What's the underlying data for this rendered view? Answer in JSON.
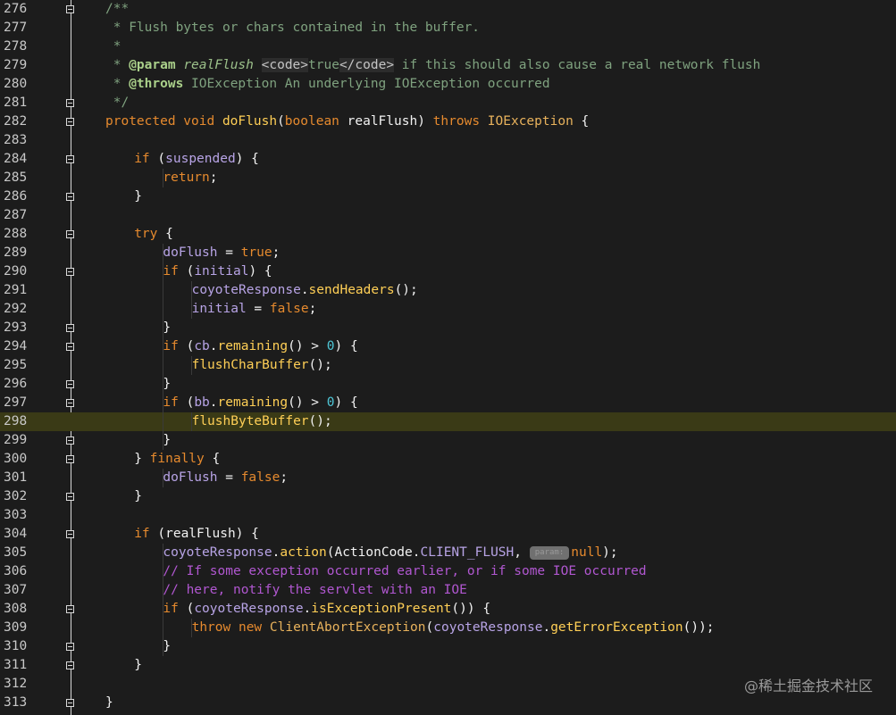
{
  "editor": {
    "active_line": 298,
    "lines": [
      {
        "n": 276,
        "indent": 0,
        "fold": true,
        "tokens": [
          {
            "t": "/**",
            "c": "comment"
          }
        ]
      },
      {
        "n": 277,
        "indent": 0,
        "fold": false,
        "tokens": [
          {
            "t": " * Flush bytes or chars contained in the buffer.",
            "c": "comment"
          }
        ]
      },
      {
        "n": 278,
        "indent": 0,
        "fold": false,
        "tokens": [
          {
            "t": " *",
            "c": "comment"
          }
        ]
      },
      {
        "n": 279,
        "indent": 0,
        "fold": false,
        "tokens": [
          {
            "t": " * ",
            "c": "comment"
          },
          {
            "t": "@param",
            "c": "doctag"
          },
          {
            "t": " ",
            "c": "comment"
          },
          {
            "t": "realFlush",
            "c": "docparam"
          },
          {
            "t": " ",
            "c": "comment"
          },
          {
            "t": "<code>",
            "c": "codetag"
          },
          {
            "t": "true",
            "c": "comment"
          },
          {
            "t": "</code>",
            "c": "codetag"
          },
          {
            "t": " if this should also cause a real network flush",
            "c": "comment"
          }
        ]
      },
      {
        "n": 280,
        "indent": 0,
        "fold": false,
        "tokens": [
          {
            "t": " * ",
            "c": "comment"
          },
          {
            "t": "@throws",
            "c": "doctag"
          },
          {
            "t": " IOException An underlying IOException occurred",
            "c": "comment"
          }
        ]
      },
      {
        "n": 281,
        "indent": 0,
        "fold": true,
        "tokens": [
          {
            "t": " */",
            "c": "comment"
          }
        ]
      },
      {
        "n": 282,
        "indent": 0,
        "fold": true,
        "tokens": [
          {
            "t": "protected void ",
            "c": "kw"
          },
          {
            "t": "doFlush",
            "c": "method"
          },
          {
            "t": "(",
            "c": "plain"
          },
          {
            "t": "boolean ",
            "c": "kw"
          },
          {
            "t": "realFlush) ",
            "c": "plain"
          },
          {
            "t": "throws ",
            "c": "kw"
          },
          {
            "t": "IOException",
            "c": "type"
          },
          {
            "t": " {",
            "c": "plain"
          }
        ]
      },
      {
        "n": 283,
        "indent": 0,
        "fold": false,
        "tokens": []
      },
      {
        "n": 284,
        "indent": 1,
        "fold": true,
        "tokens": [
          {
            "t": "if ",
            "c": "kw"
          },
          {
            "t": "(",
            "c": "plain"
          },
          {
            "t": "suspended",
            "c": "field"
          },
          {
            "t": ") {",
            "c": "plain"
          }
        ]
      },
      {
        "n": 285,
        "indent": 2,
        "fold": false,
        "tokens": [
          {
            "t": "return",
            "c": "kw"
          },
          {
            "t": ";",
            "c": "plain"
          }
        ]
      },
      {
        "n": 286,
        "indent": 1,
        "fold": true,
        "tokens": [
          {
            "t": "}",
            "c": "plain"
          }
        ]
      },
      {
        "n": 287,
        "indent": 0,
        "fold": false,
        "tokens": []
      },
      {
        "n": 288,
        "indent": 1,
        "fold": true,
        "tokens": [
          {
            "t": "try",
            "c": "kw"
          },
          {
            "t": " {",
            "c": "plain"
          }
        ]
      },
      {
        "n": 289,
        "indent": 2,
        "fold": false,
        "tokens": [
          {
            "t": "doFlush",
            "c": "field"
          },
          {
            "t": " = ",
            "c": "plain"
          },
          {
            "t": "true",
            "c": "kw"
          },
          {
            "t": ";",
            "c": "plain"
          }
        ]
      },
      {
        "n": 290,
        "indent": 2,
        "fold": true,
        "tokens": [
          {
            "t": "if ",
            "c": "kw"
          },
          {
            "t": "(",
            "c": "plain"
          },
          {
            "t": "initial",
            "c": "field"
          },
          {
            "t": ") {",
            "c": "plain"
          }
        ]
      },
      {
        "n": 291,
        "indent": 3,
        "fold": false,
        "tokens": [
          {
            "t": "coyoteResponse",
            "c": "field"
          },
          {
            "t": ".",
            "c": "plain"
          },
          {
            "t": "sendHeaders",
            "c": "method"
          },
          {
            "t": "();",
            "c": "plain"
          }
        ]
      },
      {
        "n": 292,
        "indent": 3,
        "fold": false,
        "tokens": [
          {
            "t": "initial",
            "c": "field"
          },
          {
            "t": " = ",
            "c": "plain"
          },
          {
            "t": "false",
            "c": "kw"
          },
          {
            "t": ";",
            "c": "plain"
          }
        ]
      },
      {
        "n": 293,
        "indent": 2,
        "fold": true,
        "tokens": [
          {
            "t": "}",
            "c": "plain"
          }
        ]
      },
      {
        "n": 294,
        "indent": 2,
        "fold": true,
        "tokens": [
          {
            "t": "if ",
            "c": "kw"
          },
          {
            "t": "(",
            "c": "plain"
          },
          {
            "t": "cb",
            "c": "field"
          },
          {
            "t": ".",
            "c": "plain"
          },
          {
            "t": "remaining",
            "c": "method"
          },
          {
            "t": "() > ",
            "c": "plain"
          },
          {
            "t": "0",
            "c": "num"
          },
          {
            "t": ") {",
            "c": "plain"
          }
        ]
      },
      {
        "n": 295,
        "indent": 3,
        "fold": false,
        "tokens": [
          {
            "t": "flushCharBuffer",
            "c": "method"
          },
          {
            "t": "();",
            "c": "plain"
          }
        ]
      },
      {
        "n": 296,
        "indent": 2,
        "fold": true,
        "tokens": [
          {
            "t": "}",
            "c": "plain"
          }
        ]
      },
      {
        "n": 297,
        "indent": 2,
        "fold": true,
        "tokens": [
          {
            "t": "if ",
            "c": "kw"
          },
          {
            "t": "(",
            "c": "plain"
          },
          {
            "t": "bb",
            "c": "field"
          },
          {
            "t": ".",
            "c": "plain"
          },
          {
            "t": "remaining",
            "c": "method"
          },
          {
            "t": "() > ",
            "c": "plain"
          },
          {
            "t": "0",
            "c": "num"
          },
          {
            "t": ") {",
            "c": "plain"
          }
        ]
      },
      {
        "n": 298,
        "indent": 3,
        "fold": false,
        "tokens": [
          {
            "t": "flushByteBuffer",
            "c": "method"
          },
          {
            "t": "();",
            "c": "plain"
          }
        ]
      },
      {
        "n": 299,
        "indent": 2,
        "fold": true,
        "tokens": [
          {
            "t": "}",
            "c": "plain"
          }
        ]
      },
      {
        "n": 300,
        "indent": 1,
        "fold": true,
        "tokens": [
          {
            "t": "} ",
            "c": "plain"
          },
          {
            "t": "finally",
            "c": "kw"
          },
          {
            "t": " {",
            "c": "plain"
          }
        ]
      },
      {
        "n": 301,
        "indent": 2,
        "fold": false,
        "tokens": [
          {
            "t": "doFlush",
            "c": "field"
          },
          {
            "t": " = ",
            "c": "plain"
          },
          {
            "t": "false",
            "c": "kw"
          },
          {
            "t": ";",
            "c": "plain"
          }
        ]
      },
      {
        "n": 302,
        "indent": 1,
        "fold": true,
        "tokens": [
          {
            "t": "}",
            "c": "plain"
          }
        ]
      },
      {
        "n": 303,
        "indent": 0,
        "fold": false,
        "tokens": []
      },
      {
        "n": 304,
        "indent": 1,
        "fold": true,
        "tokens": [
          {
            "t": "if ",
            "c": "kw"
          },
          {
            "t": "(realFlush) {",
            "c": "plain"
          }
        ]
      },
      {
        "n": 305,
        "indent": 2,
        "fold": false,
        "tokens": [
          {
            "t": "coyoteResponse",
            "c": "field"
          },
          {
            "t": ".",
            "c": "plain"
          },
          {
            "t": "action",
            "c": "method"
          },
          {
            "t": "(ActionCode.",
            "c": "plain"
          },
          {
            "t": "CLIENT_FLUSH",
            "c": "field"
          },
          {
            "t": ", ",
            "c": "plain"
          },
          {
            "t": "param:",
            "c": "hint"
          },
          {
            "t": "null",
            "c": "kw"
          },
          {
            "t": ");",
            "c": "plain"
          }
        ]
      },
      {
        "n": 306,
        "indent": 2,
        "fold": false,
        "tokens": [
          {
            "t": "// If some exception occurred earlier, or if some IOE occurred",
            "c": "linecomment"
          }
        ]
      },
      {
        "n": 307,
        "indent": 2,
        "fold": false,
        "tokens": [
          {
            "t": "// here, notify the servlet with an IOE",
            "c": "linecomment"
          }
        ]
      },
      {
        "n": 308,
        "indent": 2,
        "fold": true,
        "tokens": [
          {
            "t": "if ",
            "c": "kw"
          },
          {
            "t": "(",
            "c": "plain"
          },
          {
            "t": "coyoteResponse",
            "c": "field"
          },
          {
            "t": ".",
            "c": "plain"
          },
          {
            "t": "isExceptionPresent",
            "c": "method"
          },
          {
            "t": "()) {",
            "c": "plain"
          }
        ]
      },
      {
        "n": 309,
        "indent": 3,
        "fold": false,
        "tokens": [
          {
            "t": "throw new ",
            "c": "kw"
          },
          {
            "t": "ClientAbortException",
            "c": "type"
          },
          {
            "t": "(",
            "c": "plain"
          },
          {
            "t": "coyoteResponse",
            "c": "field"
          },
          {
            "t": ".",
            "c": "plain"
          },
          {
            "t": "getErrorException",
            "c": "method"
          },
          {
            "t": "());",
            "c": "plain"
          }
        ]
      },
      {
        "n": 310,
        "indent": 2,
        "fold": true,
        "tokens": [
          {
            "t": "}",
            "c": "plain"
          }
        ]
      },
      {
        "n": 311,
        "indent": 1,
        "fold": true,
        "tokens": [
          {
            "t": "}",
            "c": "plain"
          }
        ]
      },
      {
        "n": 312,
        "indent": 0,
        "fold": false,
        "tokens": []
      },
      {
        "n": 313,
        "indent": 0,
        "fold": true,
        "tokens": [
          {
            "t": "}",
            "c": "plain"
          }
        ]
      }
    ]
  },
  "colors": {
    "background": "#1c1c1c",
    "highlight": "#3a3a16"
  },
  "watermark": "@稀土掘金技术社区"
}
